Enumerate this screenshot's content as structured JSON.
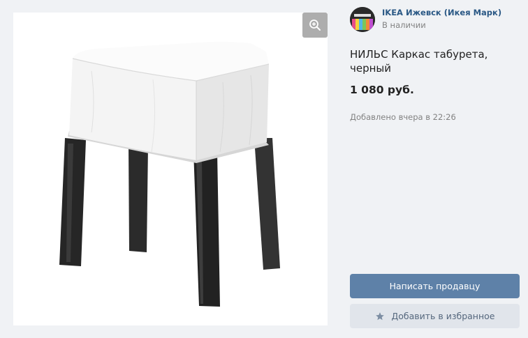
{
  "seller": {
    "name": "IKEA Ижевск (Икея Марк)",
    "status": "В наличии"
  },
  "product": {
    "title": "НИЛЬС Каркас табурета, черный",
    "price": "1 080 руб.",
    "added": "Добавлено вчера в 22:26"
  },
  "actions": {
    "write_seller": "Написать продавцу",
    "add_favorite": "Добавить в избранное"
  },
  "colors": {
    "primary_button": "#5e81a8",
    "secondary_button": "#e1e5eb",
    "link": "#2a5885",
    "muted_text": "#828282"
  },
  "icons": {
    "zoom": "zoom-in-icon",
    "favorite": "star-icon"
  }
}
